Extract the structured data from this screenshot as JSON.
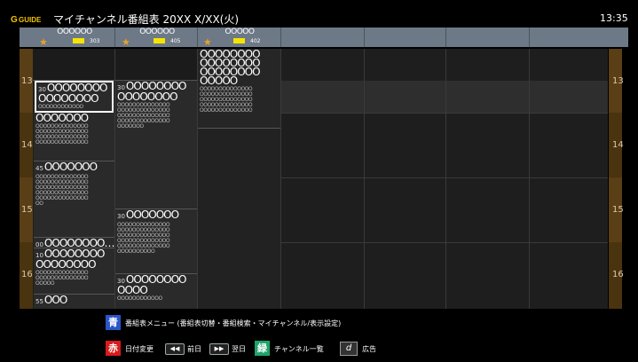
{
  "header": {
    "logo_text": "GGUIDE",
    "title": "マイチャンネル番組表 20XX X/XX(火)",
    "clock": "13:35"
  },
  "channels": [
    {
      "name": "OOOOOO",
      "number": "303"
    },
    {
      "name": "OOOOOO",
      "number": "405"
    },
    {
      "name": "OOOOO",
      "number": "402"
    }
  ],
  "hours": [
    "13",
    "14",
    "15",
    "16"
  ],
  "programs": {
    "ch1": [
      {
        "min": "30",
        "title": "OOOOOOOO\nOOOOOOOO",
        "desc": "OOOOOOOOOOOO"
      },
      {
        "min": "",
        "title": "OOOOOOO",
        "desc": "OOOOOOOOOOOOOO\nOOOOOOOOOOOOOO\nOOOOOOOOOOOOOO\nOOOOOOOOOOOOOO"
      },
      {
        "min": "45",
        "title": "OOOOOOO",
        "desc": "OOOOOOOOOOOOOO\nOOOOOOOOOOOOOO\nOOOOOOOOOOOOOO\nOOOOOOOOOOOOOO\nOOOOOOOOOOOOOO\nOO"
      },
      {
        "min": "00",
        "title": "OOOOOOOO…",
        "desc": ""
      },
      {
        "min": "10",
        "title": "OOOOOOOO\nOOOOOOOO",
        "desc": "OOOOOOOOOOOOOO\nOOOOOOOOOOOOOO\nOOOOO"
      },
      {
        "min": "55",
        "title": "OOO",
        "desc": ""
      }
    ],
    "ch2": [
      {
        "min": "30",
        "title": "OOOOOOOO\nOOOOOOOO",
        "desc": "OOOOOOOOOOOOOO\nOOOOOOOOOOOOOO\nOOOOOOOOOOOOOO\nOOOOOOOOOOOOOO\nOOOOOOO"
      },
      {
        "min": "30",
        "title": "OOOOOOO",
        "desc": "OOOOOOOOOOOOOO\nOOOOOOOOOOOOOO\nOOOOOOOOOOOOOO\nOOOOOOOOOOOOOO\nOOOOOOOOOOOOOO\nOOOOOOOOOO"
      },
      {
        "min": "30",
        "title": "OOOOOOOO\nOOOO",
        "desc": "OOOOOOOOOOOO"
      }
    ],
    "ch3": [
      {
        "min": "",
        "title": "OOOOOOOO\nOOOOOOOO\nOOOOOOOO\nOOOOO",
        "desc": "OOOOOOOOOOOOOO\nOOOOOOOOOOOOOO\nOOOOOOOOOOOOOO\nOOOOOOOOOOOOOO\nOOOOOOOOOOOOOO"
      }
    ]
  },
  "legend": {
    "blue_key": "青",
    "blue_text": "番組表メニュー (番組表切替・番組検索・マイチャンネル/表示設定)",
    "red_key": "赤",
    "red_text": "日付変更",
    "prev_icon": "skip-back-icon",
    "prev_text": "前日",
    "next_icon": "skip-forward-icon",
    "next_text": "翌日",
    "green_key": "緑",
    "green_text": "チャンネル一覧",
    "d_key": "d",
    "d_text": "広告"
  },
  "colors": {
    "blue": "#2b56c8",
    "red": "#d81b1b",
    "green": "#1fa36a",
    "gold": "#e7a12c",
    "yellow": "#f5e400",
    "hour_bar": "#6b4b1b"
  }
}
